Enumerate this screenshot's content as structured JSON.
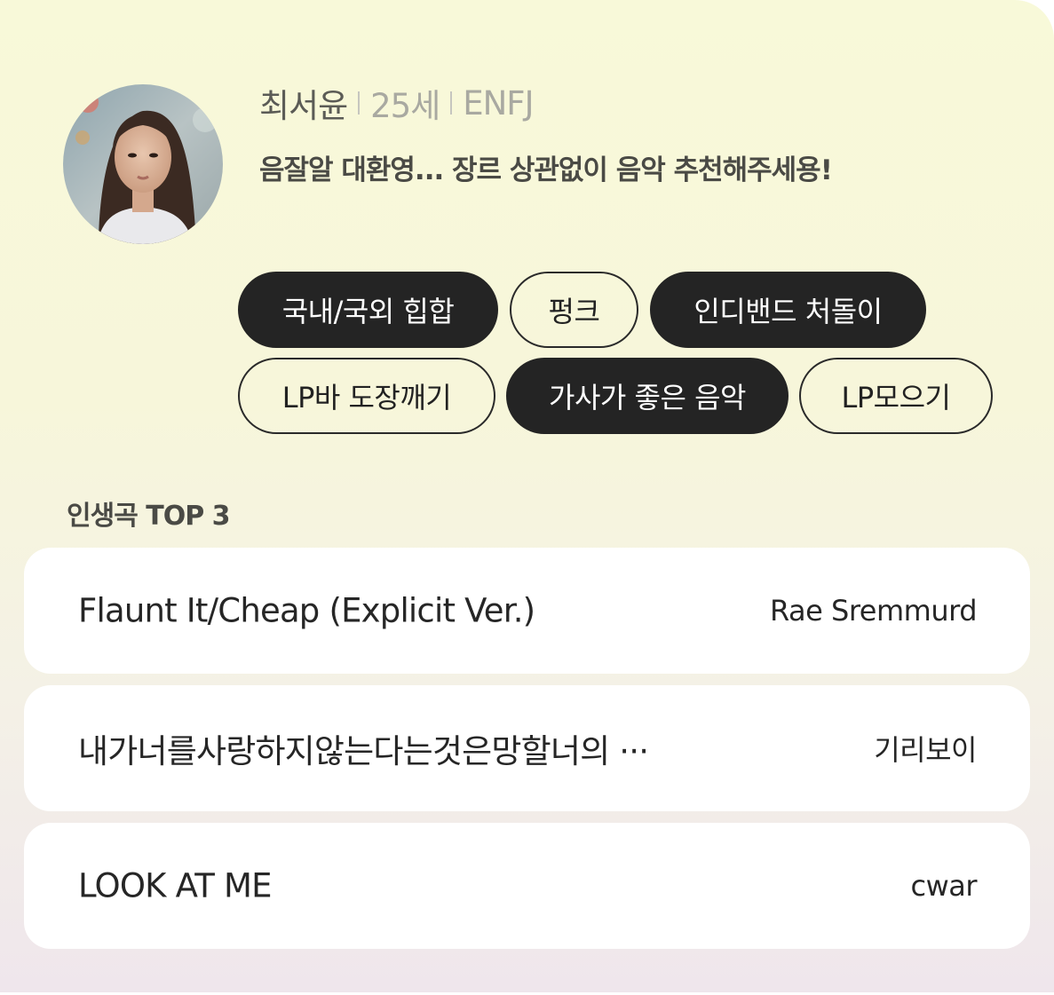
{
  "profile": {
    "name": "최서윤",
    "age": "25세",
    "mbti": "ENFJ",
    "bio": "음잘알 대환영... 장르 상관없이 음악 추천해주세용!"
  },
  "tags": [
    {
      "label": "국내/국외 힙합",
      "selected": true
    },
    {
      "label": "펑크",
      "selected": false
    },
    {
      "label": "인디밴드 처돌이",
      "selected": true
    },
    {
      "label": "LP바 도장깨기",
      "selected": false
    },
    {
      "label": "가사가 좋은 음악",
      "selected": true
    },
    {
      "label": "LP모으기",
      "selected": false
    }
  ],
  "top_songs": {
    "title": "인생곡 TOP 3",
    "items": [
      {
        "title": "Flaunt It/Cheap (Explicit Ver.)",
        "artist": "Rae Sremmurd"
      },
      {
        "title": "내가너를사랑하지않는다는것은망할너의 ···",
        "artist": "기리보이"
      },
      {
        "title": "LOOK AT ME",
        "artist": "cwar"
      }
    ]
  },
  "colors": {
    "tag_selected_bg": "#242424",
    "tag_selected_text": "#ffffff",
    "tag_outline_border": "#2a2a2a",
    "card_bg": "#ffffff"
  },
  "icons": {
    "avatar": "profile-photo"
  }
}
